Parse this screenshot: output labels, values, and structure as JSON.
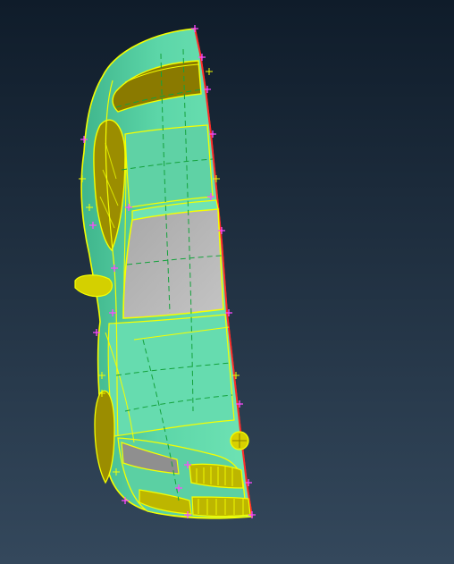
{
  "viewport": {
    "background_top": "#0f1c2a",
    "background_bottom": "#34485c"
  },
  "model": {
    "surface_color": "#5cd6a8",
    "surface_shade": "#3fb58c",
    "glass_color": "#b0b0b0",
    "edge_color": "#f5ff00",
    "iso_color": "#14a23c",
    "sym_edge_color": "#ff2a2a",
    "vertex_color": "#ff49ff"
  }
}
